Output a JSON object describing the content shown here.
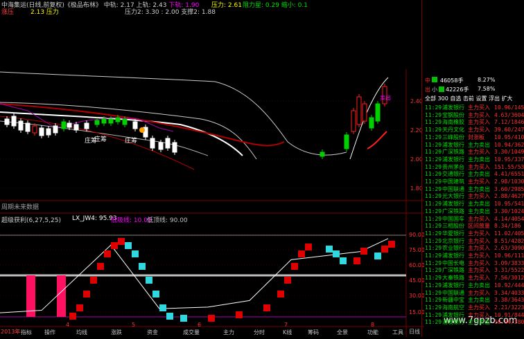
{
  "header": {
    "line1_left": "中海集运(日线,前复权)《极品布林》 中轨: 2.17 上轨: 2.43",
    "line1_down": "下轨: 1.90",
    "line1_right": "压力: 2.61",
    "line1_green": "阻力星: 0.29 缩小: 0.1",
    "line2_left": "涨压",
    "line2_mid": "2.13 压力",
    "line2_tail": "压力2: 3.30 : 2.00 支撑2: 1.88",
    "sub_caption": "周期未来数据",
    "ind_title": "超级获利(6,27,5,25)",
    "ind_lx": "LX_JW4: 95.93",
    "ind_low": "低吸线: 10.00",
    "ind_high": "低顶线: 90.00",
    "period": "日线",
    "year": "2013年"
  },
  "price_axis": [
    "2.40",
    "2.20",
    "2.00",
    "1.80"
  ],
  "ind_axis": [
    "90.00",
    "75.00",
    "60.00",
    "45.00",
    "30.00",
    "15.00"
  ],
  "x_labels": [
    "4",
    "5",
    "6",
    "7",
    "8",
    "9"
  ],
  "annotations": [
    "庄筹",
    "庄筹",
    "庄筹"
  ],
  "sell_label": "卖出",
  "watermark": "www.7gpzb.com",
  "bottom_tabs": [
    "指标",
    "操作",
    "均线",
    "涨跌",
    "资金",
    "成交量",
    "主力",
    "分时",
    "K线",
    "筹码",
    "全景",
    "功能",
    "工具"
  ],
  "side": {
    "mid_label": "中",
    "mid_vol": "46058手",
    "mid_pct": "8.27%",
    "out_label": "出",
    "out_sub": "小",
    "out_vol": "42226手",
    "out_pct": "7.58%",
    "tabs": [
      "全部",
      "300",
      "自选",
      "击前",
      "设置",
      "浮出",
      "扩大"
    ],
    "rows": [
      {
        "time": "11:29",
        "name": "浦发银行",
        "act": "主力买入",
        "val": "10.96/14596"
      },
      {
        "time": "11:29",
        "name": "宝钢股份",
        "act": "主力买入",
        "val": "4.63/3604"
      },
      {
        "time": "11:29",
        "name": "海南橡胶",
        "act": "主力买入",
        "val": "7.12/1846"
      },
      {
        "time": "11:29",
        "name": "天丹文化",
        "act": "主力买入",
        "val": "39.60/2475"
      },
      {
        "time": "11:29",
        "name": "三峰股份",
        "act": "封涨板",
        "val": "10.95/4103"
      },
      {
        "time": "11:29",
        "name": "浦发银行",
        "act": "主力卖出",
        "val": "10.94/3623"
      },
      {
        "time": "11:29",
        "name": "广深铁路",
        "act": "主力买入",
        "val": "3.30/10495"
      },
      {
        "time": "11:29",
        "name": "浦发银行",
        "act": "主力卖出",
        "val": "10.95/3377"
      },
      {
        "time": "11:29",
        "name": "贵州茅台",
        "act": "主力买入",
        "val": "151.55/530"
      },
      {
        "time": "11:29",
        "name": "交通银行",
        "act": "主力卖出",
        "val": "4.41/6551"
      },
      {
        "time": "11:29",
        "name": "中国建筑",
        "act": "主力买入",
        "val": "2.98/10301"
      },
      {
        "time": "11:29",
        "name": "中国联通",
        "act": "主力卖出",
        "val": "3.60/2985"
      },
      {
        "time": "11:29",
        "name": "光大银行",
        "act": "主力买入",
        "val": "2.88/4627"
      },
      {
        "time": "11:29",
        "name": "浦发银行",
        "act": "主力卖出",
        "val": "10.95/5413"
      },
      {
        "time": "11:29",
        "name": "广深铁路",
        "act": "主力卖出",
        "val": "3.30/10245"
      },
      {
        "time": "11:29",
        "name": "中国国车",
        "act": "主力买入",
        "val": "4.14/4054"
      },
      {
        "time": "11:29",
        "name": "三相股份",
        "act": "区间放量",
        "val": "8.34/186"
      },
      {
        "time": "11:29",
        "name": "华夏银行",
        "act": "主力买入",
        "val": "11.02/4054"
      },
      {
        "time": "11:29",
        "name": "北京银行",
        "act": "主力买入",
        "val": "8.51/4282"
      },
      {
        "time": "11:29",
        "name": "农业银行",
        "act": "主力买入",
        "val": "2.63/3090"
      },
      {
        "time": "11:29",
        "name": "浦发银行",
        "act": "主力买入",
        "val": "10.96/11163"
      },
      {
        "time": "11:29",
        "name": "中国长电",
        "act": "主力买入",
        "val": "3.09/3833"
      },
      {
        "time": "11:29",
        "name": "广深铁路",
        "act": "主力买入",
        "val": "3.31/5522"
      },
      {
        "time": "11:29",
        "name": "大秦铁路",
        "act": "主力买入",
        "val": "7.56/3012"
      },
      {
        "time": "11:29",
        "name": "浦发银行",
        "act": "主力卖出",
        "val": "10.92/4440"
      },
      {
        "time": "11:29",
        "name": "中国联通",
        "act": "主力买入",
        "val": "3.34/4033"
      },
      {
        "time": "11:29",
        "name": "新疆中宝",
        "act": "主力卖出",
        "val": "3.38/3643"
      },
      {
        "time": "11:29",
        "name": "海南航空",
        "act": "主力买入",
        "val": "2.21/3223"
      },
      {
        "time": "11:29",
        "name": "浦发银行",
        "act": "主力买入",
        "val": "10.91/8443"
      },
      {
        "time": "11:29",
        "name": "浦发银行",
        "act": "主力卖出",
        "val": "10.94/3800"
      }
    ]
  },
  "chart_data": {
    "type": "line",
    "title": "超级获利(6,27,5,25)",
    "x": [
      "4",
      "5",
      "6",
      "7",
      "8",
      "9"
    ],
    "ylim": [
      0,
      100
    ],
    "series": [
      {
        "name": "LX_JW4",
        "values": [
          5,
          8,
          88,
          10,
          12,
          20,
          70,
          75,
          80,
          95.93
        ]
      }
    ]
  }
}
